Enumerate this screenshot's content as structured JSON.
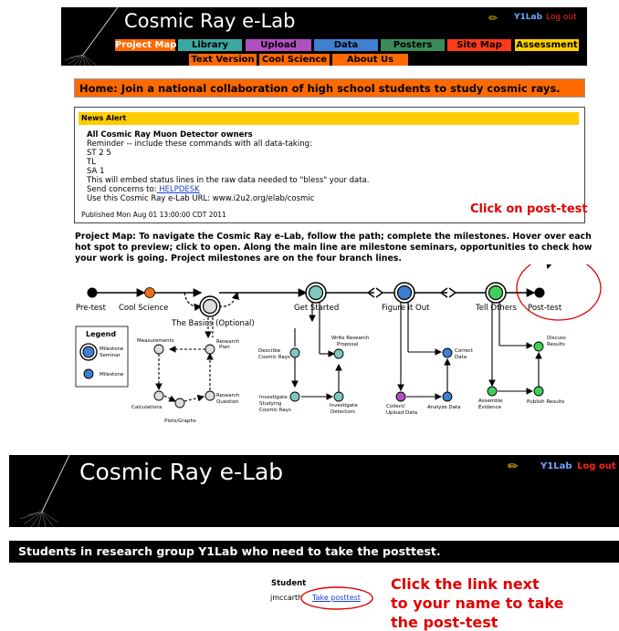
{
  "header_top": {
    "title": "Cosmic Ray e-Lab",
    "user": "Y1Lab",
    "logout": "Log out",
    "nav_row1": [
      "Project Map",
      "Library",
      "Upload",
      "Data",
      "Posters",
      "Site Map",
      "Assessment"
    ],
    "nav_row2": [
      "Text Version",
      "Cool Science",
      "About Us"
    ],
    "colors": {
      "project_map": "#ff6a00",
      "library": "#3aa7a0",
      "upload": "#b04fbf",
      "data": "#3f7fcf",
      "posters": "#3a8a5a",
      "site_map": "#ff3b1a",
      "assessment": "#ffd000",
      "row2": "#ff6a00"
    }
  },
  "home_banner": "Home: Join a national collaboration of high school students to study cosmic rays.",
  "news": {
    "header": "News Alert",
    "title": "All Cosmic Ray Muon Detector owners",
    "lines": [
      "Reminder -- include these commands with all data-taking:",
      "ST 2 5",
      "TL",
      "SA 1",
      "This will embed status lines in the raw data needed to \"bless\" your data."
    ],
    "concerns_prefix": "Send concerns to:",
    "concerns_link": " HELPDESK",
    "url_line": "Use this Cosmic Ray e-Lab URL: www.i2u2.org/elab/cosmic",
    "published": "Published Mon Aug 01 13:00:00 CDT 2011"
  },
  "intro_text": "Project Map: To navigate the Cosmic Ray e-Lab, follow the path; complete the milestones. Hover over each hot spot to preview; click to open. Along the main line are milestone seminars, opportunities to check how your work is going. Project milestones are on the four branch lines.",
  "annotations": {
    "post_test": "Click on post-test",
    "link_line1": "Click the link next",
    "link_line2": "to your name to take",
    "link_line3": "the post-test"
  },
  "map": {
    "main": [
      "Pre-test",
      "Cool Science",
      "The Basics (Optional)",
      "Get Started",
      "Figure it Out",
      "Tell Others",
      "Post-test"
    ],
    "legend_title": "Legend",
    "legend_seminar": "Milestone Seminar",
    "legend_seminar_1": "Milestone",
    "legend_seminar_2": "Seminar",
    "legend_milestone": "Milestone",
    "basics": [
      "Measurements",
      "Research Plan",
      "Calculations",
      "Plots/Graphs",
      "Research Question"
    ],
    "basics_lines": {
      "research_plan_1": "Research",
      "research_plan_2": "Plan",
      "research_question_1": "Research",
      "research_question_2": "Question"
    },
    "get_started_lines": {
      "write_1": "Write Research",
      "write_2": "Proposal",
      "describe_1": "Describe",
      "describe_2": "Cosmic Rays",
      "inv_study_1": "Investigate",
      "inv_study_2": "Studying",
      "inv_study_3": "Cosmic Rays",
      "inv_det_1": "Investigate",
      "inv_det_2": "Detectors"
    },
    "figure_lines": {
      "collect_1": "Collect/",
      "collect_2": "Upload Data",
      "analyze": "Analyze Data",
      "correct_1": "Correct",
      "correct_2": "Data"
    },
    "tell_lines": {
      "discuss_1": "Discuss",
      "discuss_2": "Results",
      "assemble_1": "Assemble",
      "assemble_2": "Evidence",
      "publish": "Publish Results"
    }
  },
  "header_bottom": {
    "title": "Cosmic Ray e-Lab",
    "user": "Y1Lab",
    "logout": "Log out"
  },
  "group_bar": "Students in research group Y1Lab who need to take the posttest.",
  "student_table": {
    "header": "Student",
    "student_name": "jmccarth",
    "link": "Take posttest"
  }
}
